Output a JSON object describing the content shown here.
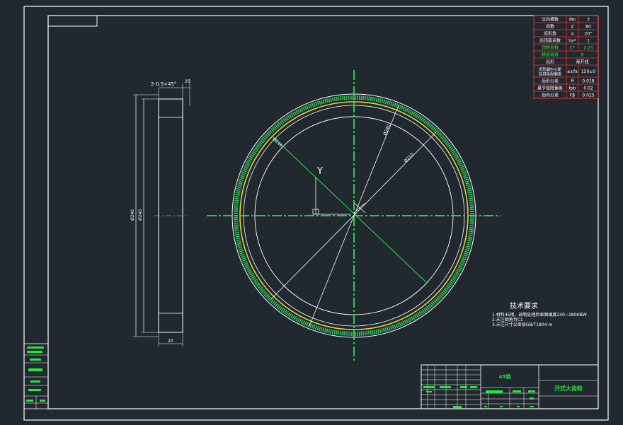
{
  "params_table": {
    "rows": [
      {
        "name": "法向模数",
        "symbol": "Mn",
        "value": "3"
      },
      {
        "name": "齿数",
        "symbol": "Z",
        "value": "80"
      },
      {
        "name": "齿形角",
        "symbol": "α",
        "value": "20°"
      },
      {
        "name": "齿顶高系数",
        "symbol": "ha*",
        "value": "1"
      },
      {
        "name": "顶隙系数",
        "symbol": "C*",
        "value": "0.25"
      },
      {
        "name": "精度等级",
        "symbol": "",
        "value": "8"
      },
      {
        "name": "齿形",
        "symbol": "",
        "value": "渐开线"
      },
      {
        "name": "齿轮副中心距及其极限偏差",
        "symbol": "a±fa",
        "value": "150±0"
      },
      {
        "name": "齿形公差",
        "symbol": "ff",
        "value": "0.018"
      },
      {
        "name": "基节极限偏差",
        "symbol": "fpb",
        "value": "0.02"
      },
      {
        "name": "齿向公差",
        "symbol": "Fβ",
        "value": "0.025"
      }
    ]
  },
  "tech_requirements": {
    "title": "技术要求",
    "items": [
      "1.材料45钢，调制处理后表面硬度240~280HBW",
      "2.未注倒角为C1",
      "3.未注尺寸公差按GB/T1804-m"
    ]
  },
  "side_view": {
    "chamfer_label": "2-0.5×45°",
    "top_dim": "25",
    "dia_outer": "Ø246",
    "dia_inner": "Ø240",
    "width_dim": "20"
  },
  "front_view": {
    "label_outer": "Ø246",
    "label_mid": "Ø240",
    "label_inner": "Ø210",
    "axis_label": "Y"
  },
  "title_block": {
    "material": "45钢",
    "part_name": "开式大齿轮"
  }
}
